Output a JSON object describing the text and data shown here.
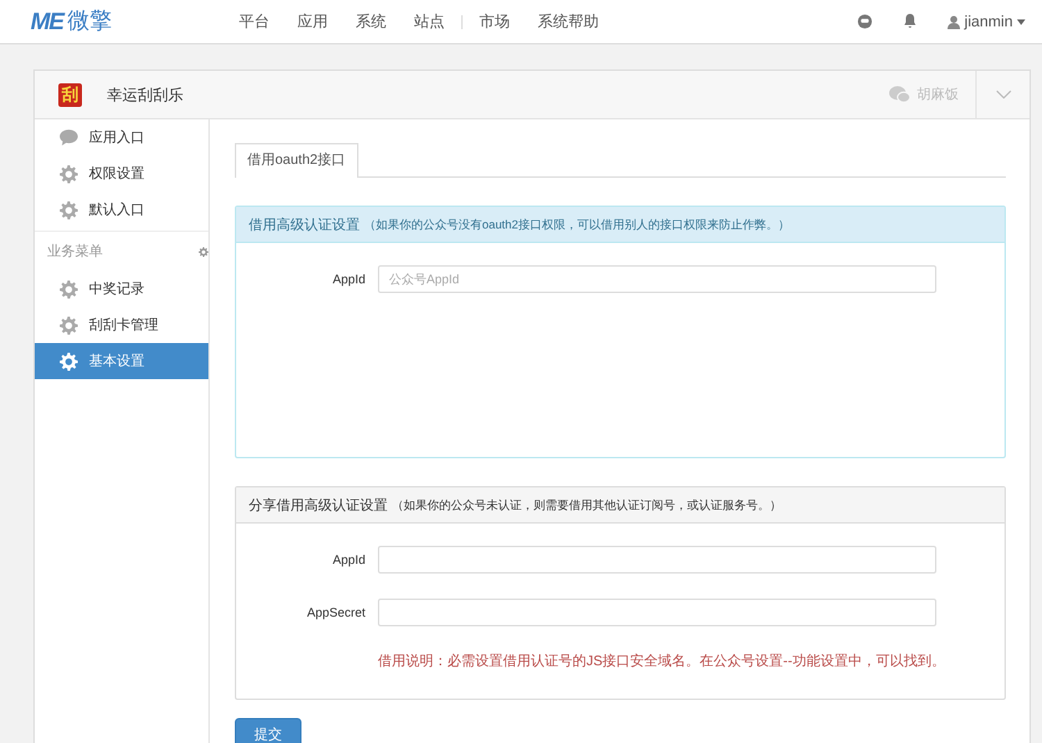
{
  "nav": {
    "logo": "ME",
    "logo_text": "微擎",
    "links": [
      {
        "label": "平台"
      },
      {
        "label": "应用"
      },
      {
        "label": "系统"
      },
      {
        "label": "站点"
      },
      {
        "label": "市场"
      },
      {
        "label": "系统帮助"
      }
    ],
    "user": "jianmin"
  },
  "app": {
    "title": "幸运刮刮乐",
    "icon_char": "刮",
    "account": "胡麻饭"
  },
  "sidebar": {
    "items": [
      {
        "label": "应用入口",
        "kind": "chat",
        "selected": false
      },
      {
        "label": "权限设置",
        "kind": "gear",
        "selected": false
      },
      {
        "label": "默认入口",
        "kind": "gear",
        "selected": false
      }
    ],
    "group": "业务菜单",
    "group_items": [
      {
        "label": "中奖记录",
        "kind": "gear",
        "selected": false
      },
      {
        "label": "刮刮卡管理",
        "kind": "gear",
        "selected": false
      },
      {
        "label": "基本设置",
        "kind": "gear",
        "selected": true
      }
    ]
  },
  "tabs": [
    {
      "label": "借用oauth2接口",
      "selected": true
    }
  ],
  "panels": [
    {
      "kind": "info",
      "title": "借用高级认证设置",
      "hint": "（如果你的公众号没有oauth2接口权限，可以借用别人的接口权限来防止作弊。）",
      "fields": [
        {
          "label": "AppId",
          "placeholder": "公众号AppId"
        }
      ]
    },
    {
      "kind": "default",
      "title": "分享借用高级认证设置",
      "hint": "（如果你的公众号未认证，则需要借用其他认证订阅号，或认证服务号。）",
      "fields": [
        {
          "label": "AppId"
        },
        {
          "label": "AppSecret"
        }
      ],
      "note": "借用说明：必需设置借用认证号的JS接口安全域名。在公众号设置--功能设置中，可以找到。"
    }
  ],
  "submit": "提交"
}
